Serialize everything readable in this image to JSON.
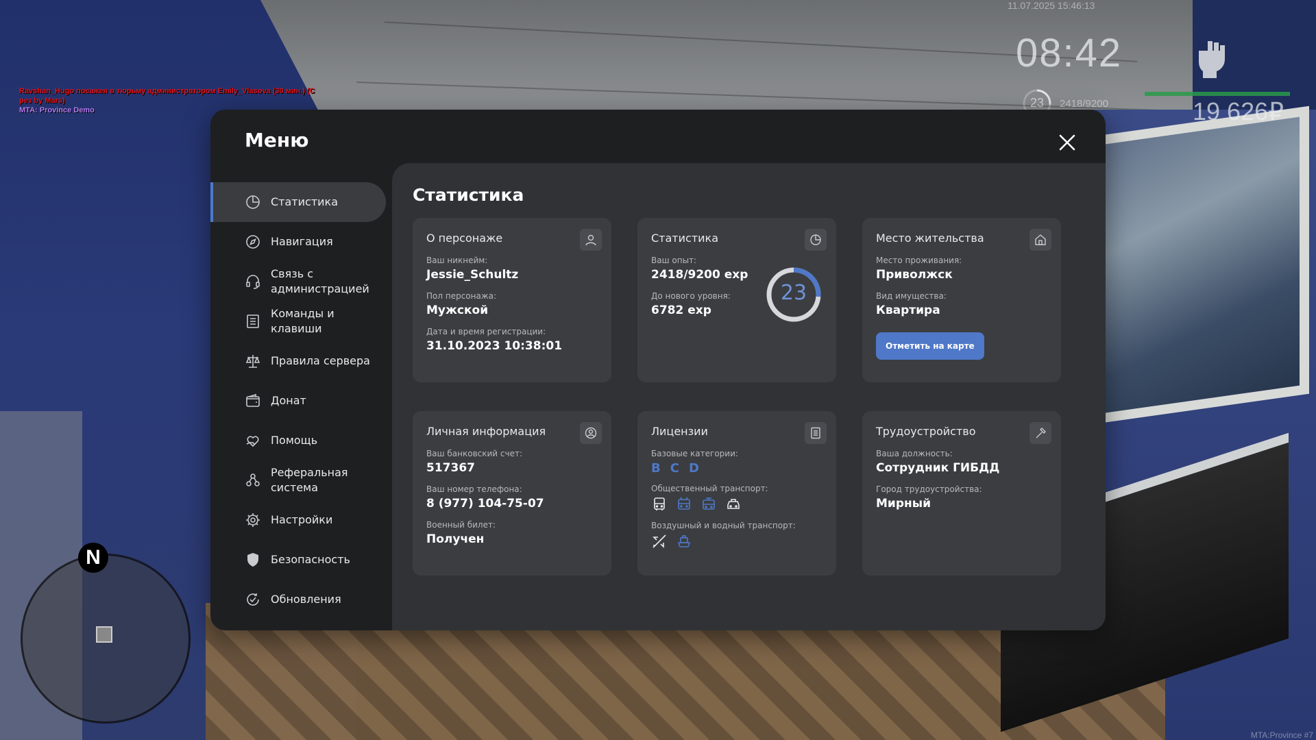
{
  "chat": {
    "line1": "Ravshan_Hugo посажен в тюрьму администратором Emily_Vlasova (30 мин.) (С",
    "line2": "рез by Mars)",
    "line3": "MTA: Province Demo"
  },
  "hud": {
    "datetime": "11.07.2025 15:46:13",
    "time": "08:42",
    "level": "23",
    "exp": "2418/9200",
    "money": "19 626₽",
    "footer": "MTA:Province #7",
    "health_fraction": 1.0
  },
  "radar": {
    "north": "N"
  },
  "menu": {
    "title": "Меню",
    "nav": [
      {
        "label": "Статистика",
        "icon": "pie-chart-icon",
        "active": true
      },
      {
        "label": "Навигация",
        "icon": "compass-icon"
      },
      {
        "label": "Связь с\nадминистрацией",
        "icon": "headset-icon"
      },
      {
        "label": "Команды и\nклавиши",
        "icon": "list-icon"
      },
      {
        "label": "Правила сервера",
        "icon": "scales-icon"
      },
      {
        "label": "Донат",
        "icon": "wallet-icon"
      },
      {
        "label": "Помощь",
        "icon": "heart-hand-icon"
      },
      {
        "label": "Реферальная\nсистема",
        "icon": "people-icon"
      },
      {
        "label": "Настройки",
        "icon": "gear-icon"
      },
      {
        "label": "Безопасность",
        "icon": "shield-icon"
      },
      {
        "label": "Обновления",
        "icon": "refresh-icon"
      }
    ]
  },
  "content": {
    "title": "Статистика",
    "character": {
      "title": "О персонаже",
      "nickname_label": "Ваш никнейм:",
      "nickname": "Jessie_Schultz",
      "gender_label": "Пол персонажа:",
      "gender": "Мужской",
      "reg_label": "Дата и время регистрации:",
      "reg": "31.10.2023 10:38:01"
    },
    "stats": {
      "title": "Статистика",
      "exp_label": "Ваш опыт:",
      "exp": "2418/9200 exp",
      "next_label": "До нового уровня:",
      "next": "6782 exp",
      "level": "23",
      "progress": 0.263
    },
    "residence": {
      "title": "Место жительства",
      "place_label": "Место проживания:",
      "place": "Приволжск",
      "property_label": "Вид имущества:",
      "property": "Квартира",
      "button": "Отметить на карте"
    },
    "personal": {
      "title": "Личная информация",
      "bank_label": "Ваш банковский счет:",
      "bank": "517367",
      "phone_label": "Ваш номер телефона:",
      "phone": "8 (977) 104-75-07",
      "military_label": "Военный билет:",
      "military": "Получен"
    },
    "licenses": {
      "title": "Лицензии",
      "base_label": "Базовые категории:",
      "categories": [
        "B",
        "C",
        "D"
      ],
      "public_label": "Общественный транспорт:",
      "public_icons": [
        "bus-icon",
        "trolleybus-icon",
        "tram-icon",
        "taxi-icon"
      ],
      "air_label": "Воздушный и водный транспорт:",
      "air_icons": [
        "plane-icon",
        "boat-icon"
      ]
    },
    "job": {
      "title": "Трудоустройство",
      "position_label": "Ваша должность:",
      "position": "Сотрудник ГИБДД",
      "city_label": "Город трудоустройства:",
      "city": "Мирный"
    }
  },
  "colors": {
    "accent": "#4f78c8",
    "panel": "#1e1f21",
    "content": "#303236",
    "card": "#3b3d41"
  }
}
